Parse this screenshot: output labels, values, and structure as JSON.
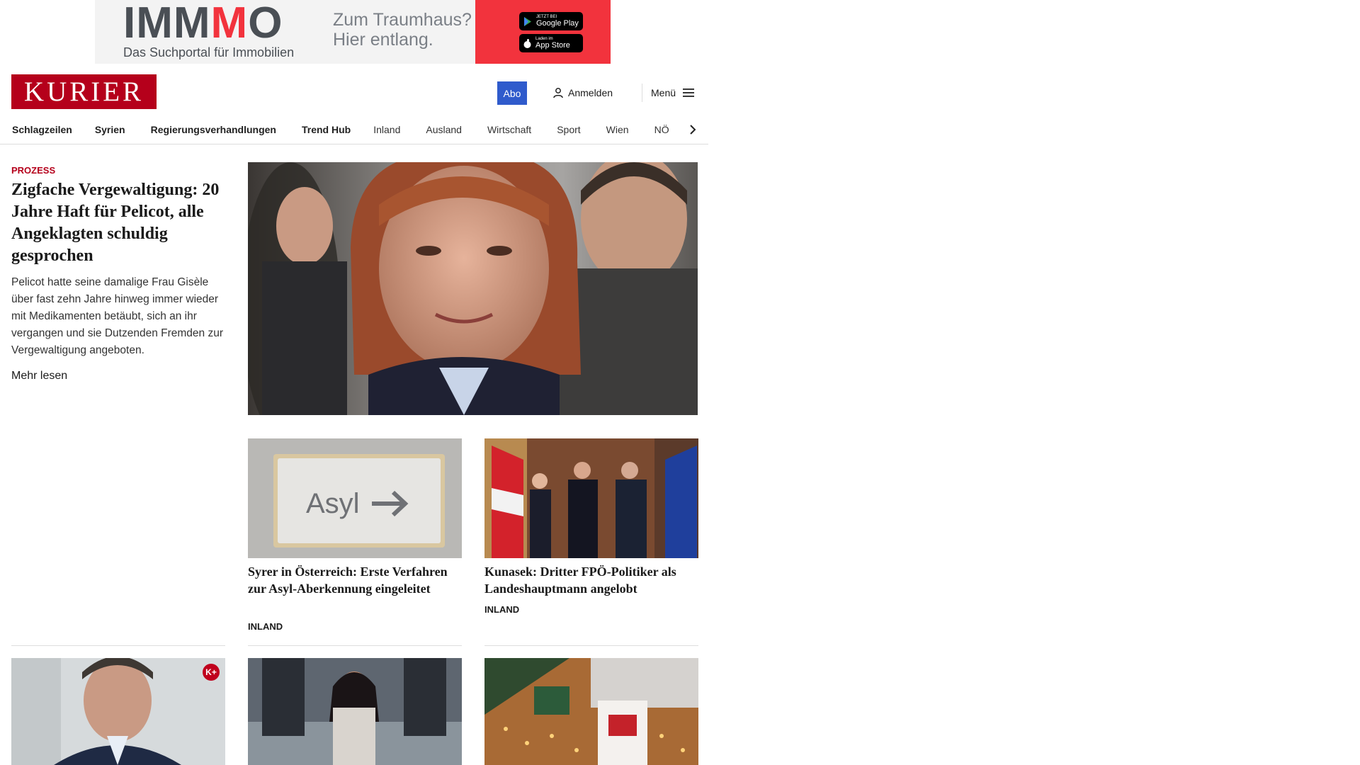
{
  "ad": {
    "logo_a": "IMM",
    "logo_m": "M",
    "logo_b": "O",
    "subtitle": "Das Suchportal für Immobilien",
    "claim_line1": "Zum Traumhaus?",
    "claim_line2": "Hier entlang.",
    "google_small": "JETZT BEI",
    "google_label": "Google Play",
    "apple_small": "Laden im",
    "apple_label": "App Store"
  },
  "header": {
    "logo": "KURIER",
    "abo_label": "Abo",
    "login_label": "Anmelden",
    "menu_label": "Menü"
  },
  "nav": {
    "items": [
      "Schlagzeilen",
      "Syrien",
      "Regierungsverhandlungen",
      "Trend Hub",
      "Inland",
      "Ausland",
      "Wirtschaft",
      "Sport",
      "Wien",
      "NÖ"
    ]
  },
  "lead": {
    "kicker": "PROZESS",
    "title": "Zigfache Vergewaltigung: 20 Jahre Haft für Pelicot, alle Angeklagten schul­dig gesprochen",
    "teaser": "Pelicot hatte seine damalige Frau Gisèle über fast zehn Jahre hinweg immer wieder mit Medikamenten betäubt, sich an ihr vergangen und sie Dutzenden Fremden zur Vergewaltigung angeboten.",
    "more": "Mehr lesen"
  },
  "cards": [
    {
      "sign_text": "Asyl",
      "title": "Syrer in Österreich: Erste Verfah­ren zur Asyl-Aberkennung eingeleitet",
      "category": "INLAND"
    },
    {
      "title": "Kunasek: Dritter FPÖ-Politiker als Landeshauptmann angelobt",
      "category": "INLAND"
    }
  ],
  "premium_badge": "K+",
  "colors": {
    "brand_red": "#b5001b",
    "abo_blue": "#2f5bcc",
    "ad_red": "#f2333d"
  }
}
